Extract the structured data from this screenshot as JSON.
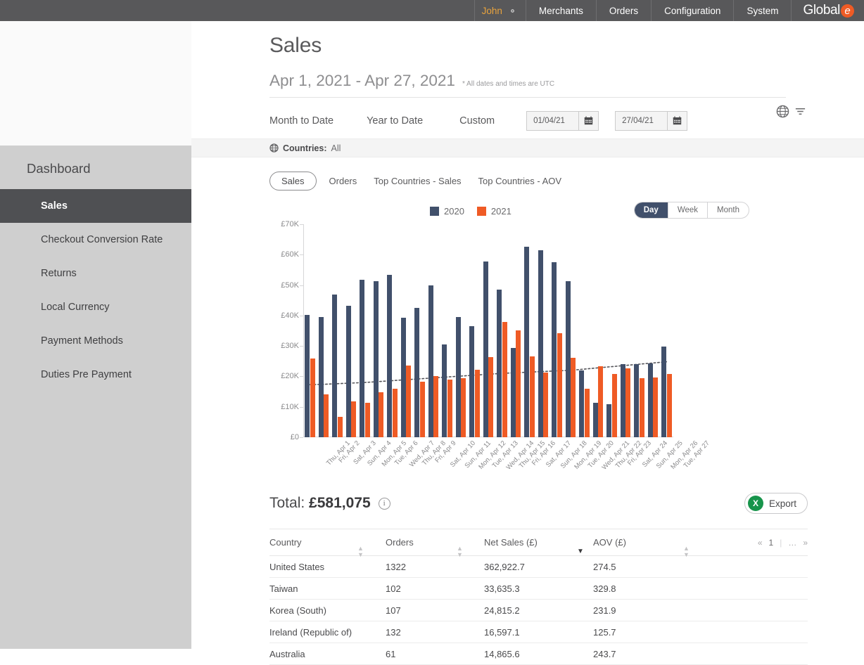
{
  "topnav": {
    "user": "John",
    "gear_icon": "gear-icon",
    "items": [
      "Merchants",
      "Orders",
      "Configuration",
      "System"
    ],
    "logo_text": "Global",
    "logo_mark": "e",
    "logo_accent": "#ef5b25",
    "bg": "#58585a",
    "user_color": "#e8a33d"
  },
  "sidebar": {
    "title": "Dashboard",
    "items": [
      {
        "label": "Sales",
        "active": true
      },
      {
        "label": "Checkout Conversion Rate",
        "active": false
      },
      {
        "label": "Returns",
        "active": false
      },
      {
        "label": "Local Currency",
        "active": false
      },
      {
        "label": "Payment Methods",
        "active": false
      },
      {
        "label": "Duties Pre Payment",
        "active": false
      }
    ],
    "bg": "#cfcfcf",
    "active_bg": "#4f5053"
  },
  "header": {
    "title": "Sales",
    "date_range": "Apr 1, 2021 - Apr 27, 2021",
    "utc_note": "* All dates and times are UTC",
    "presets": [
      "Month to Date",
      "Year to Date",
      "Custom"
    ],
    "date_from": "01/04/21",
    "date_to": "27/04/21",
    "calendar_icon": "calendar-icon",
    "globe_icon": "globe-icon",
    "filter_icon": "filter-icon"
  },
  "filter_bar": {
    "globe_icon": "globe-icon",
    "label": "Countries:",
    "value": "All"
  },
  "tabs": [
    {
      "label": "Sales",
      "active": true
    },
    {
      "label": "Orders",
      "active": false
    },
    {
      "label": "Top Countries - Sales",
      "active": false
    },
    {
      "label": "Top Countries - AOV",
      "active": false
    }
  ],
  "granularity": {
    "options": [
      "Day",
      "Week",
      "Month"
    ],
    "selected": "Day"
  },
  "chart_data": {
    "type": "bar",
    "title": "",
    "xlabel": "",
    "ylabel": "",
    "ylim": [
      0,
      70000
    ],
    "ytick_labels": [
      "£0",
      "£10K",
      "£20K",
      "£30K",
      "£40K",
      "£50K",
      "£60K",
      "£70K"
    ],
    "ytick_values": [
      0,
      10000,
      20000,
      30000,
      40000,
      50000,
      60000,
      70000
    ],
    "grid": false,
    "legend_position": "top-center",
    "legend": [
      "2020",
      "2021"
    ],
    "colors": {
      "2020": "#41506b",
      "2021": "#ef5b25",
      "trend": "#55555a"
    },
    "categories": [
      "Thu, Apr 1",
      "Fri, Apr 2",
      "Sat, Apr 3",
      "Sun, Apr 4",
      "Mon, Apr 5",
      "Tue, Apr 6",
      "Wed, Apr 7",
      "Thu, Apr 8",
      "Fri, Apr 9",
      "Sat, Apr 10",
      "Sun, Apr 11",
      "Mon, Apr 12",
      "Tue, Apr 13",
      "Wed, Apr 14",
      "Thu, Apr 15",
      "Fri, Apr 16",
      "Sat, Apr 17",
      "Sun, Apr 18",
      "Mon, Apr 19",
      "Tue, Apr 20",
      "Wed, Apr 21",
      "Thu, Apr 22",
      "Fri, Apr 23",
      "Sat, Apr 24",
      "Sun, Apr 25",
      "Mon, Apr 26",
      "Tue, Apr 27"
    ],
    "series": [
      {
        "name": "2020",
        "values": [
          40300,
          39500,
          46800,
          43300,
          51800,
          51300,
          53400,
          39300,
          42600,
          49800,
          30400,
          39500,
          36400,
          57800,
          48500,
          29400,
          62500,
          61400,
          57500,
          51200,
          21900,
          11400,
          10900,
          24000,
          24100,
          24200,
          29700
        ]
      },
      {
        "name": "2021",
        "values": [
          25800,
          14200,
          6700,
          11900,
          11300,
          14900,
          15900,
          23500,
          18300,
          20100,
          19000,
          19500,
          22200,
          26300,
          37800,
          35100,
          26500,
          21300,
          34100,
          26200,
          15900,
          23300,
          20800,
          22700,
          19400,
          19700,
          20800
        ]
      }
    ],
    "trend": {
      "name": "trend",
      "style": "dotted",
      "values": [
        17300,
        17400,
        17600,
        17800,
        18000,
        18300,
        18600,
        18900,
        19200,
        19500,
        19800,
        20100,
        20400,
        20700,
        21000,
        21200,
        21400,
        21600,
        21800,
        22000,
        22400,
        22800,
        23200,
        23600,
        24000,
        24400,
        24800
      ]
    }
  },
  "total": {
    "label": "Total:",
    "value": "£581,075",
    "info_icon": "info-icon"
  },
  "export": {
    "label": "Export",
    "icon_letter": "X",
    "icon_color": "#17944b"
  },
  "table": {
    "columns": [
      {
        "label": "Country",
        "sort": "none"
      },
      {
        "label": "Orders",
        "sort": "none"
      },
      {
        "label": "Net Sales (£)",
        "sort": "desc"
      },
      {
        "label": "AOV (£)",
        "sort": "none"
      }
    ],
    "rows": [
      [
        "United States",
        "1322",
        "362,922.7",
        "274.5"
      ],
      [
        "Taiwan",
        "102",
        "33,635.3",
        "329.8"
      ],
      [
        "Korea (South)",
        "107",
        "24,815.2",
        "231.9"
      ],
      [
        "Ireland (Republic of)",
        "132",
        "16,597.1",
        "125.7"
      ],
      [
        "Australia",
        "61",
        "14,865.6",
        "243.7"
      ]
    ],
    "pagination": {
      "first": "«",
      "current": "1",
      "ellipsis": "…",
      "last": "»"
    }
  }
}
